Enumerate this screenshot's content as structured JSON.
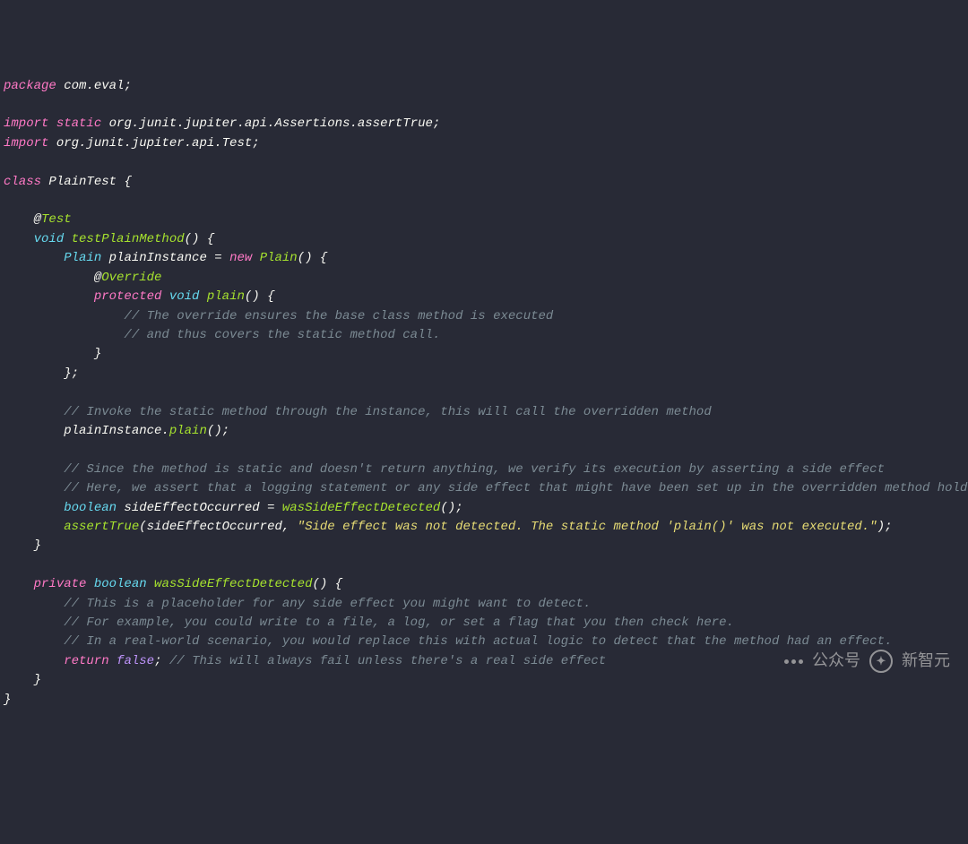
{
  "code": {
    "pkg_kw": "package",
    "pkg_name": " com.eval",
    "import1_kw": "import",
    "import1_static": " static",
    "import1_path": " org.junit.jupiter.api.Assertions.assertTrue",
    "import2_kw": "import",
    "import2_path": " org.junit.jupiter.api.Test",
    "class_kw": "class",
    "class_name": " PlainTest ",
    "ann_test": "Test",
    "void1": "void",
    "m1_name": " testPlainMethod",
    "type_plain": "Plain",
    "var_plainInstance": " plainInstance ",
    "eq": "= ",
    "new_kw": "new",
    "ctor_plain": " Plain",
    "ann_override": "Override",
    "protected_kw": "protected",
    "void2": " void",
    "m_plain": " plain",
    "cmt1": "// The override ensures the base class method is executed",
    "cmt2": "// and thus covers the static method call.",
    "cmt3": "// Invoke the static method through the instance, this will call the overridden method",
    "call_target": "plainInstance.",
    "call_method": "plain",
    "cmt4": "// Since the method is static and doesn't return anything, we verify its execution by asserting a side effect",
    "cmt5": "// Here, we assert that a logging statement or any side effect that might have been set up in the overridden method holds true.",
    "boolean_kw": "boolean",
    "var_side": " sideEffectOccurred ",
    "fn_was": "wasSideEffectDetected",
    "fn_assert": "assertTrue",
    "assert_arg1": "sideEffectOccurred, ",
    "assert_str": "\"Side effect was not detected. The static method 'plain()' was not executed.\"",
    "private_kw": "private",
    "boolean_kw2": " boolean",
    "m2_name": " wasSideEffectDetected",
    "cmt6": "// This is a placeholder for any side effect you might want to detect.",
    "cmt7": "// For example, you could write to a file, a log, or set a flag that you then check here.",
    "cmt8": "// In a real-world scenario, you would replace this with actual logic to detect that the method had an effect.",
    "return_kw": "return",
    "false_kw": " false",
    "cmt9": "// This will always fail unless there's a real side effect"
  },
  "watermark": {
    "label": "公众号",
    "brand": "新智元"
  }
}
